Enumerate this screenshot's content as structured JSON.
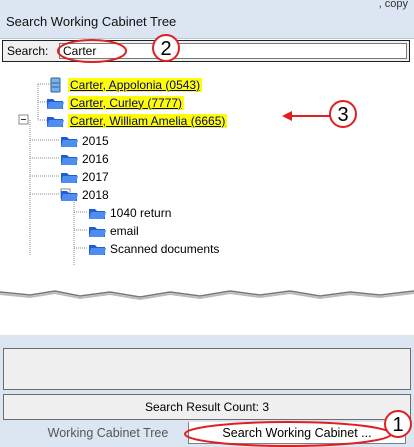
{
  "header": {
    "title": "Search Working Cabinet Tree",
    "topright_text": ", copy"
  },
  "search": {
    "label": "Search:",
    "value": "Carter"
  },
  "tree": {
    "clients": [
      {
        "label": "Carter, Appolonia (0543)"
      },
      {
        "label": "Carter, Curley (7777)"
      },
      {
        "label": "Carter, William  Amelia (6665)"
      }
    ],
    "years": [
      "2015",
      "2016",
      "2017",
      "2018"
    ],
    "year_2018_children": [
      "1040 return",
      "email",
      "Scanned documents"
    ]
  },
  "results": {
    "count_label": "Search Result Count: 3"
  },
  "tabs": [
    {
      "label": "Working Cabinet Tree"
    },
    {
      "label": "Search Working Cabinet ..."
    }
  ],
  "annotations": [
    {
      "number": "1",
      "color": "#e02020"
    },
    {
      "number": "2",
      "color": "#e02020"
    },
    {
      "number": "3",
      "color": "#e02020"
    }
  ],
  "colors": {
    "highlight": "#ffff00",
    "link": "#000080",
    "folder": "#1e5fd8",
    "panel": "#dce6f2"
  }
}
